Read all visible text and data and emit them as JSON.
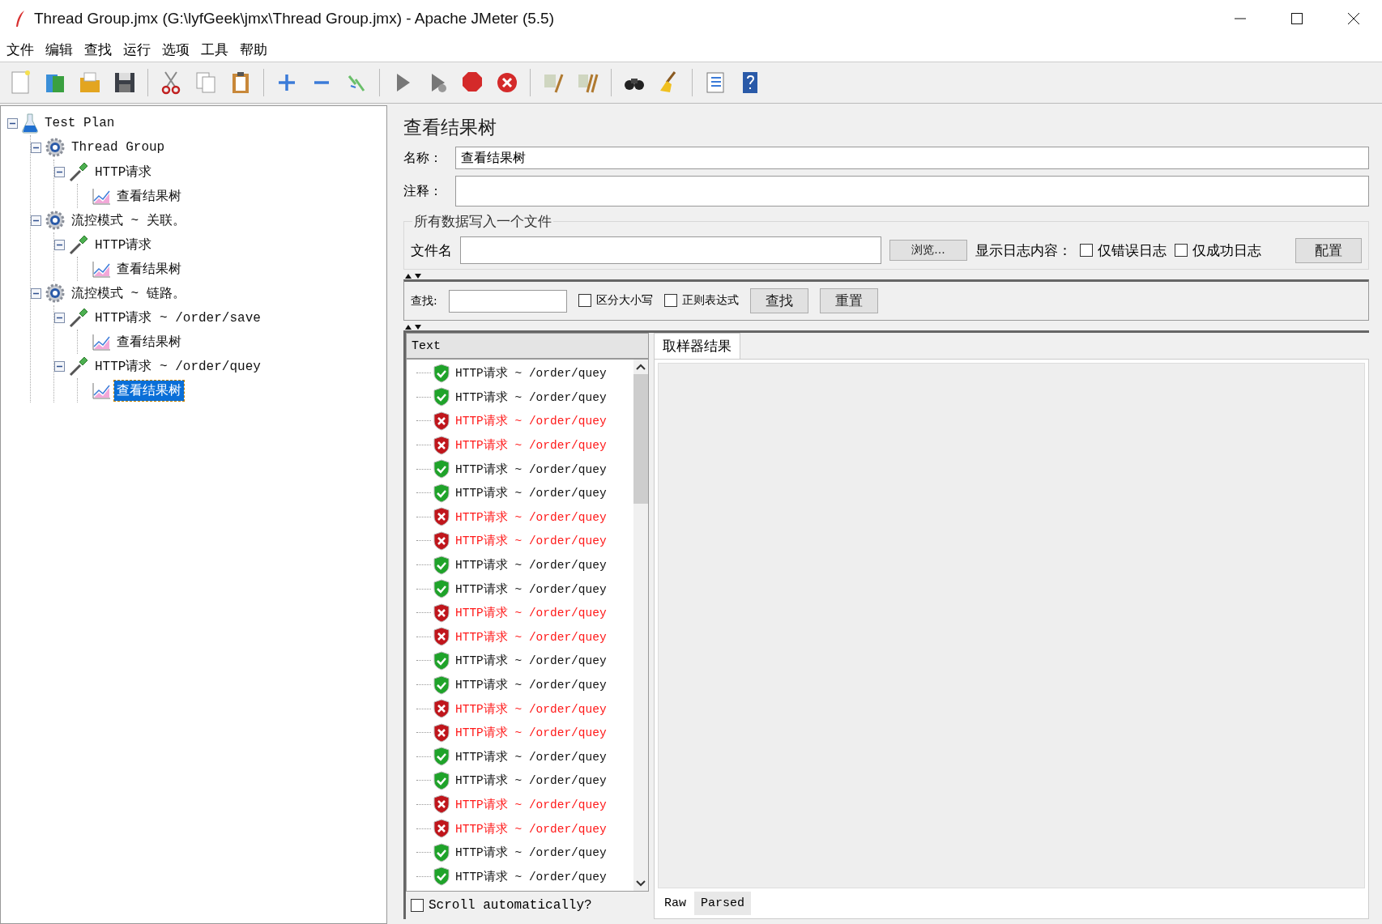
{
  "window": {
    "title": "Thread Group.jmx (G:\\lyfGeek\\jmx\\Thread Group.jmx) - Apache JMeter (5.5)"
  },
  "menu": [
    "文件",
    "编辑",
    "查找",
    "运行",
    "选项",
    "工具",
    "帮助"
  ],
  "tree": [
    {
      "label": "Test Plan",
      "kind": "plan",
      "expanded": true,
      "selected": false,
      "children": [
        {
          "label": "Thread Group",
          "kind": "group",
          "expanded": true,
          "selected": false,
          "children": [
            {
              "label": "HTTP请求",
              "kind": "sampler",
              "expanded": true,
              "selected": false,
              "children": [
                {
                  "label": "查看结果树",
                  "kind": "listener",
                  "selected": false
                }
              ]
            }
          ]
        },
        {
          "label": "流控模式 ~ 关联。",
          "kind": "group",
          "expanded": true,
          "selected": false,
          "children": [
            {
              "label": "HTTP请求",
              "kind": "sampler",
              "expanded": true,
              "selected": false,
              "children": [
                {
                  "label": "查看结果树",
                  "kind": "listener",
                  "selected": false
                }
              ]
            }
          ]
        },
        {
          "label": "流控模式 ~ 链路。",
          "kind": "group",
          "expanded": true,
          "selected": false,
          "children": [
            {
              "label": "HTTP请求 ~ /order/save",
              "kind": "sampler",
              "expanded": true,
              "selected": false,
              "children": [
                {
                  "label": "查看结果树",
                  "kind": "listener",
                  "selected": false
                }
              ]
            },
            {
              "label": "HTTP请求 ~ /order/quey",
              "kind": "sampler",
              "expanded": true,
              "selected": false,
              "children": [
                {
                  "label": "查看结果树",
                  "kind": "listener",
                  "selected": true
                }
              ]
            }
          ]
        }
      ]
    }
  ],
  "panel": {
    "title": "查看结果树",
    "name_label": "名称：",
    "name_value": "查看结果树",
    "comment_label": "注释：",
    "file_group": {
      "legend": "所有数据写入一个文件",
      "file_label": "文件名",
      "browse_button": "浏览...",
      "log_label": "显示日志内容：",
      "checkboxes": [
        {
          "label": "仅错误日志",
          "checked": false
        },
        {
          "label": "仅成功日志",
          "checked": false
        }
      ],
      "config_button": "配置"
    },
    "search": {
      "label": "查找:",
      "checkboxes": [
        {
          "label": "区分大小写",
          "checked": false
        },
        {
          "label": "正则表达式",
          "checked": false
        }
      ],
      "find_button": "查找",
      "reset_button": "重置"
    },
    "renderer": "Text",
    "results": [
      {
        "label": "HTTP请求 ~ /order/quey",
        "success": true
      },
      {
        "label": "HTTP请求 ~ /order/quey",
        "success": true
      },
      {
        "label": "HTTP请求 ~ /order/quey",
        "success": false
      },
      {
        "label": "HTTP请求 ~ /order/quey",
        "success": false
      },
      {
        "label": "HTTP请求 ~ /order/quey",
        "success": true
      },
      {
        "label": "HTTP请求 ~ /order/quey",
        "success": true
      },
      {
        "label": "HTTP请求 ~ /order/quey",
        "success": false
      },
      {
        "label": "HTTP请求 ~ /order/quey",
        "success": false
      },
      {
        "label": "HTTP请求 ~ /order/quey",
        "success": true
      },
      {
        "label": "HTTP请求 ~ /order/quey",
        "success": true
      },
      {
        "label": "HTTP请求 ~ /order/quey",
        "success": false
      },
      {
        "label": "HTTP请求 ~ /order/quey",
        "success": false
      },
      {
        "label": "HTTP请求 ~ /order/quey",
        "success": true
      },
      {
        "label": "HTTP请求 ~ /order/quey",
        "success": true
      },
      {
        "label": "HTTP请求 ~ /order/quey",
        "success": false
      },
      {
        "label": "HTTP请求 ~ /order/quey",
        "success": false
      },
      {
        "label": "HTTP请求 ~ /order/quey",
        "success": true
      },
      {
        "label": "HTTP请求 ~ /order/quey",
        "success": true
      },
      {
        "label": "HTTP请求 ~ /order/quey",
        "success": false
      },
      {
        "label": "HTTP请求 ~ /order/quey",
        "success": false
      },
      {
        "label": "HTTP请求 ~ /order/quey",
        "success": true
      },
      {
        "label": "HTTP请求 ~ /order/quey",
        "success": true
      }
    ],
    "scroll_auto": {
      "label": "Scroll automatically?",
      "checked": false
    },
    "result_tabs": [
      {
        "label": "取样器结果",
        "selected": true
      }
    ],
    "view_tabs": [
      {
        "label": "Raw",
        "selected": true
      },
      {
        "label": "Parsed",
        "selected": false
      }
    ]
  }
}
